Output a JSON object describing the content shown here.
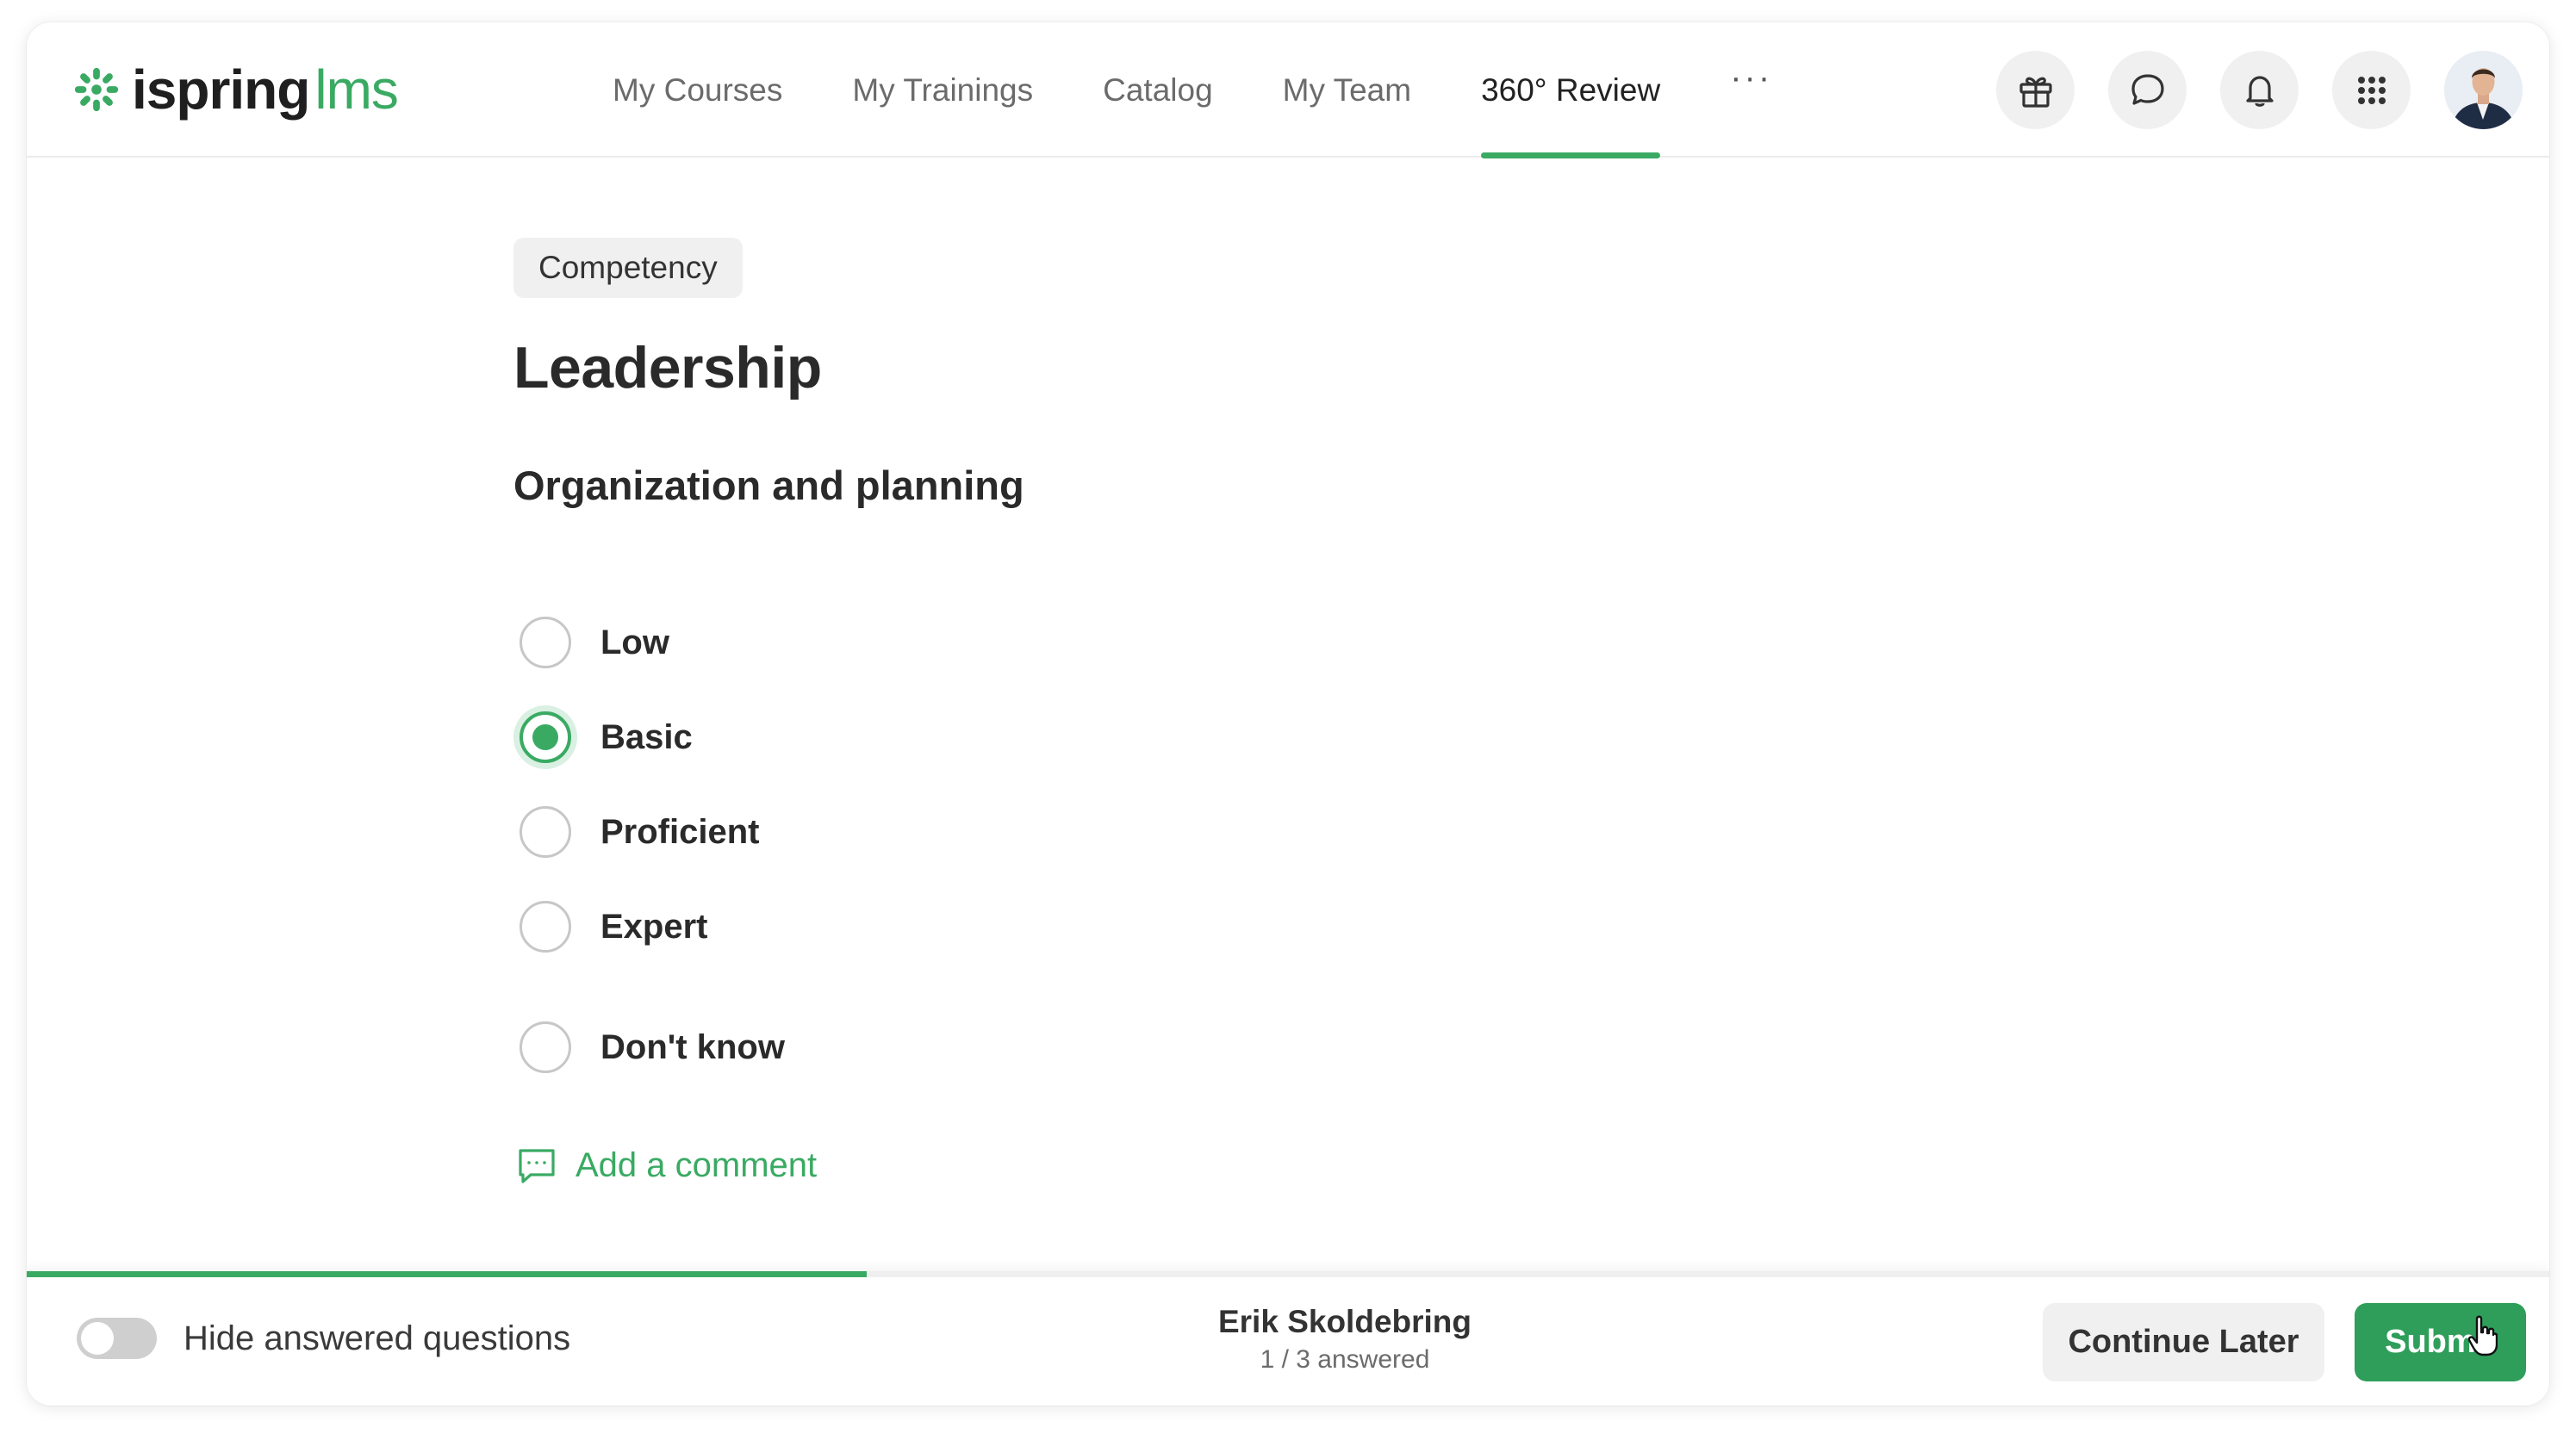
{
  "brand": {
    "name_bold": "ispring",
    "name_light": "lms",
    "accent_color": "#3aaa63"
  },
  "nav": {
    "items": [
      {
        "label": "My Courses",
        "active": false
      },
      {
        "label": "My Trainings",
        "active": false
      },
      {
        "label": "Catalog",
        "active": false
      },
      {
        "label": "My Team",
        "active": false
      },
      {
        "label": "360° Review",
        "active": true
      }
    ],
    "more_label": "···"
  },
  "header_icons": [
    "gift-icon",
    "chat-icon",
    "bell-icon",
    "apps-grid-icon"
  ],
  "content": {
    "tag": "Competency",
    "title": "Leadership",
    "question": "Organization and planning",
    "options": [
      {
        "label": "Low",
        "selected": false
      },
      {
        "label": "Basic",
        "selected": true
      },
      {
        "label": "Proficient",
        "selected": false
      },
      {
        "label": "Expert",
        "selected": false
      },
      {
        "label": "Don't know",
        "selected": false
      }
    ],
    "comment_label": "Add a comment"
  },
  "footer": {
    "progress_fraction": 0.333,
    "toggle_label": "Hide answered questions",
    "toggle_on": false,
    "reviewer_name": "Erik Skoldebring",
    "answered_text": "1 / 3 answered",
    "continue_label": "Continue Later",
    "submit_label": "Submit"
  }
}
